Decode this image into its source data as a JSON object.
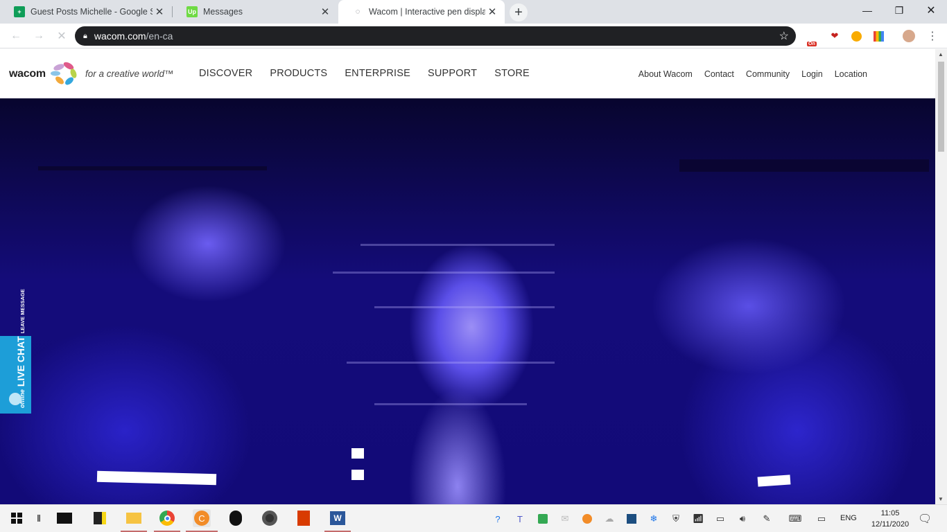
{
  "browser": {
    "tabs": [
      {
        "title": "Guest Posts Michelle - Google Sh",
        "favicon": "sheets-icon",
        "color": "#0f9d58"
      },
      {
        "title": "Messages",
        "favicon": "upwork-icon",
        "color": "#6fda44"
      },
      {
        "title": "Wacom | Interactive pen displays",
        "favicon": "loading-icon",
        "color": "#5f6368"
      }
    ],
    "new_tab_symbol": "+",
    "close_symbol": "✕",
    "url_domain": "wacom.com",
    "url_path": "/en-ca",
    "extension_badge": "On"
  },
  "site": {
    "logo_text": "wacom",
    "tagline": "for a creative world™",
    "main_nav": [
      "DISCOVER",
      "PRODUCTS",
      "ENTERPRISE",
      "SUPPORT",
      "STORE"
    ],
    "util_nav": [
      "About Wacom",
      "Contact",
      "Community",
      "Login",
      "Location"
    ]
  },
  "live_chat": {
    "status": "offline",
    "label": "LIVE CHAT",
    "sublabel": "LEAVE MESSAGE",
    "color": "#1d9ed8"
  },
  "taskbar": {
    "language": "ENG",
    "time": "11:05",
    "date": "12/11/2020"
  }
}
